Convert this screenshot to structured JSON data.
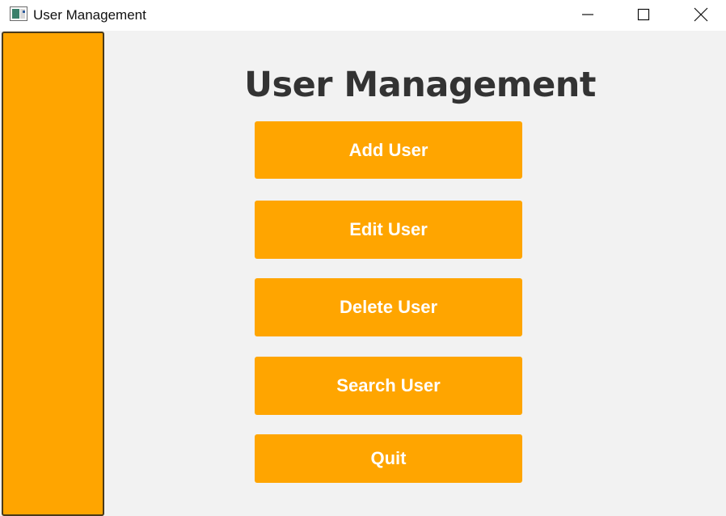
{
  "window": {
    "title": "User Management",
    "icon": "app-window-icon"
  },
  "window_controls": {
    "minimize_icon": "minimize-icon",
    "maximize_icon": "maximize-icon",
    "close_icon": "close-icon"
  },
  "main": {
    "title": "User Management",
    "buttons": [
      {
        "label": "Add User"
      },
      {
        "label": "Edit User"
      },
      {
        "label": "Delete User"
      },
      {
        "label": "Search User"
      },
      {
        "label": "Quit"
      }
    ]
  },
  "colors": {
    "accent": "#ffa500",
    "button_text": "#ffffff",
    "title_text": "#333333",
    "background": "#f2f2f2",
    "sidebar_border": "#4a3a1a"
  }
}
